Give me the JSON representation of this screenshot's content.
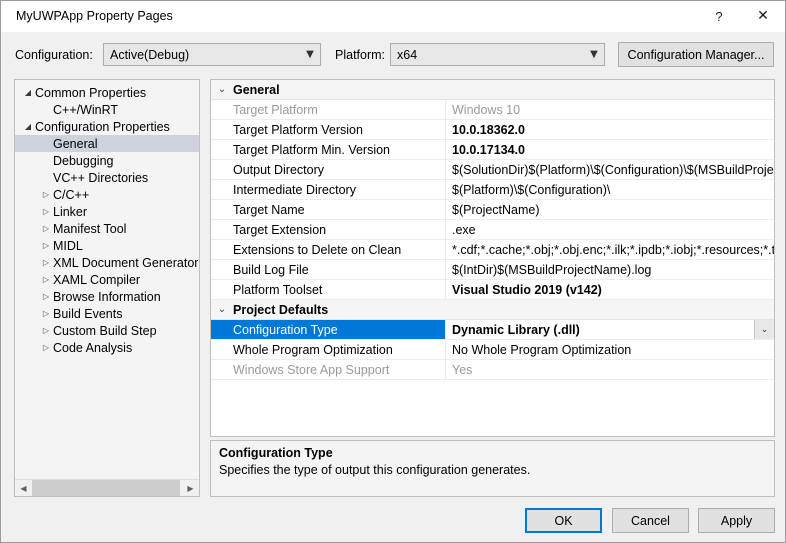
{
  "window": {
    "title": "MyUWPApp Property Pages",
    "help_icon": "question-mark-icon",
    "close_icon": "close-icon"
  },
  "config_bar": {
    "configuration_label": "Configuration:",
    "configuration_value": "Active(Debug)",
    "platform_label": "Platform:",
    "platform_value": "x64",
    "configuration_manager_button": "Configuration Manager...",
    "chevron_icon": "chevron-down-icon"
  },
  "tree": {
    "items": [
      {
        "label": "Common Properties",
        "indent": 0,
        "state": "expanded",
        "selected": false
      },
      {
        "label": "C++/WinRT",
        "indent": 1,
        "state": "leaf",
        "selected": false
      },
      {
        "label": "Configuration Properties",
        "indent": 0,
        "state": "expanded",
        "selected": false
      },
      {
        "label": "General",
        "indent": 1,
        "state": "leaf",
        "selected": true
      },
      {
        "label": "Debugging",
        "indent": 1,
        "state": "leaf",
        "selected": false
      },
      {
        "label": "VC++ Directories",
        "indent": 1,
        "state": "leaf",
        "selected": false
      },
      {
        "label": "C/C++",
        "indent": 1,
        "state": "collapsed",
        "selected": false
      },
      {
        "label": "Linker",
        "indent": 1,
        "state": "collapsed",
        "selected": false
      },
      {
        "label": "Manifest Tool",
        "indent": 1,
        "state": "collapsed",
        "selected": false
      },
      {
        "label": "MIDL",
        "indent": 1,
        "state": "collapsed",
        "selected": false
      },
      {
        "label": "XML Document Generator",
        "indent": 1,
        "state": "collapsed",
        "selected": false
      },
      {
        "label": "XAML Compiler",
        "indent": 1,
        "state": "collapsed",
        "selected": false
      },
      {
        "label": "Browse Information",
        "indent": 1,
        "state": "collapsed",
        "selected": false
      },
      {
        "label": "Build Events",
        "indent": 1,
        "state": "collapsed",
        "selected": false
      },
      {
        "label": "Custom Build Step",
        "indent": 1,
        "state": "collapsed",
        "selected": false
      },
      {
        "label": "Code Analysis",
        "indent": 1,
        "state": "collapsed",
        "selected": false
      }
    ],
    "expanded_icon": "triangle-expanded-icon",
    "collapsed_icon": "triangle-collapsed-icon",
    "scroll_left_icon": "chevron-left-icon",
    "scroll_right_icon": "chevron-right-icon"
  },
  "grid": {
    "groups": [
      {
        "title": "General",
        "chevron_icon": "chevron-down-icon",
        "rows": [
          {
            "name": "Target Platform",
            "value": "Windows 10",
            "disabled": true,
            "bold": false,
            "selected": false,
            "dropdown": false
          },
          {
            "name": "Target Platform Version",
            "value": "10.0.18362.0",
            "disabled": false,
            "bold": true,
            "selected": false,
            "dropdown": false
          },
          {
            "name": "Target Platform Min. Version",
            "value": "10.0.17134.0",
            "disabled": false,
            "bold": true,
            "selected": false,
            "dropdown": false
          },
          {
            "name": "Output Directory",
            "value": "$(SolutionDir)$(Platform)\\$(Configuration)\\$(MSBuildProjectName",
            "disabled": false,
            "bold": false,
            "selected": false,
            "dropdown": false
          },
          {
            "name": "Intermediate Directory",
            "value": "$(Platform)\\$(Configuration)\\",
            "disabled": false,
            "bold": false,
            "selected": false,
            "dropdown": false
          },
          {
            "name": "Target Name",
            "value": "$(ProjectName)",
            "disabled": false,
            "bold": false,
            "selected": false,
            "dropdown": false
          },
          {
            "name": "Target Extension",
            "value": ".exe",
            "disabled": false,
            "bold": false,
            "selected": false,
            "dropdown": false
          },
          {
            "name": "Extensions to Delete on Clean",
            "value": "*.cdf;*.cache;*.obj;*.obj.enc;*.ilk;*.ipdb;*.iobj;*.resources;*.tlb;*",
            "disabled": false,
            "bold": false,
            "selected": false,
            "dropdown": false
          },
          {
            "name": "Build Log File",
            "value": "$(IntDir)$(MSBuildProjectName).log",
            "disabled": false,
            "bold": false,
            "selected": false,
            "dropdown": false
          },
          {
            "name": "Platform Toolset",
            "value": "Visual Studio 2019 (v142)",
            "disabled": false,
            "bold": true,
            "selected": false,
            "dropdown": false
          }
        ]
      },
      {
        "title": "Project Defaults",
        "chevron_icon": "chevron-down-icon",
        "rows": [
          {
            "name": "Configuration Type",
            "value": "Dynamic Library (.dll)",
            "disabled": false,
            "bold": true,
            "selected": true,
            "dropdown": true,
            "dropdown_icon": "chevron-down-icon"
          },
          {
            "name": "Whole Program Optimization",
            "value": "No Whole Program Optimization",
            "disabled": false,
            "bold": false,
            "selected": false,
            "dropdown": false
          },
          {
            "name": "Windows Store App Support",
            "value": "Yes",
            "disabled": true,
            "bold": false,
            "selected": false,
            "dropdown": false
          }
        ]
      }
    ]
  },
  "description": {
    "title": "Configuration Type",
    "text": "Specifies the type of output this configuration generates."
  },
  "footer": {
    "ok": "OK",
    "cancel": "Cancel",
    "apply": "Apply"
  },
  "colors": {
    "accent": "#0078d7",
    "selection_inactive": "#cdd2dc",
    "dialog_background": "#f0f0f0",
    "grid_background": "#ffffff",
    "disabled_text": "#9a9a9a"
  }
}
